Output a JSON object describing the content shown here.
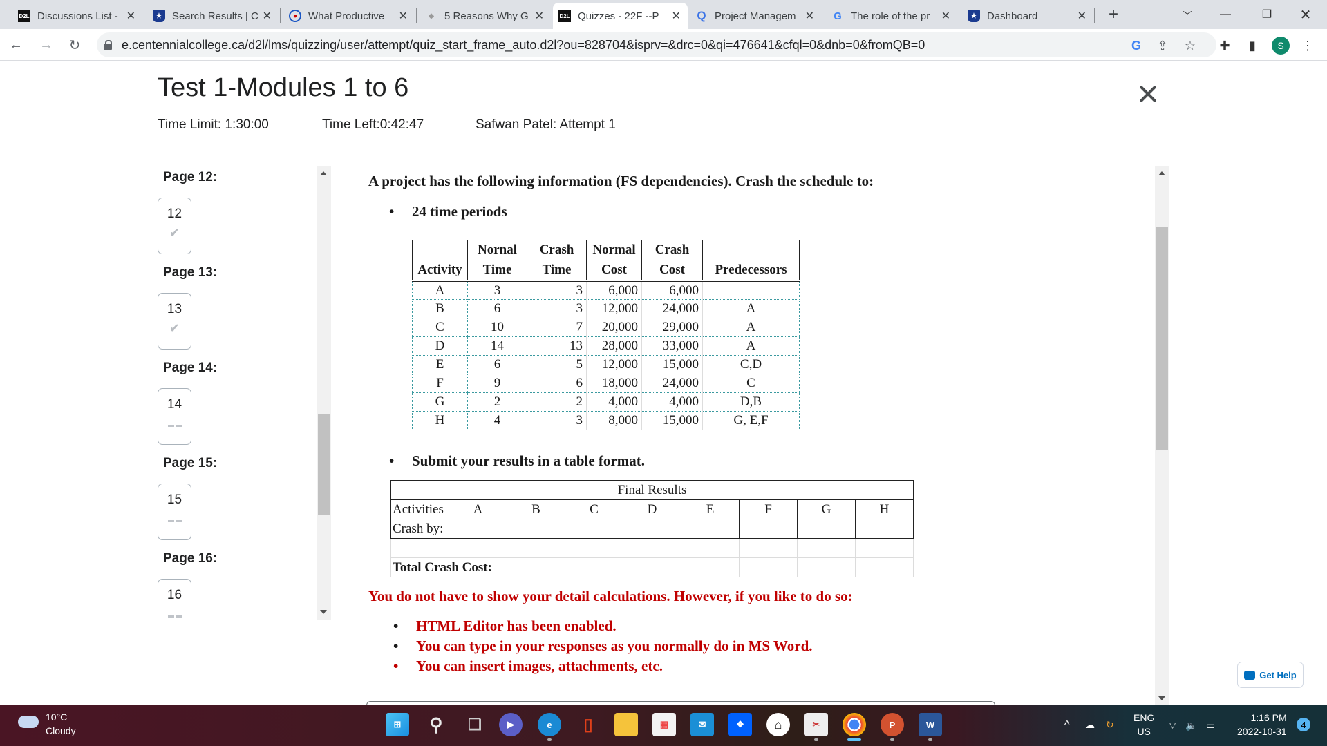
{
  "browser": {
    "tabs": [
      {
        "title": "Discussions List - ",
        "icon": "d2l-logo-icon",
        "active": false
      },
      {
        "title": "Search Results | C",
        "icon": "shield-star-icon",
        "active": false
      },
      {
        "title": "What Productive ",
        "icon": "circle-logo-icon",
        "active": false
      },
      {
        "title": "5 Reasons Why G",
        "icon": "diamond-logo-icon",
        "active": false
      },
      {
        "title": "Quizzes - 22F --P",
        "icon": "d2l-logo-icon",
        "active": true
      },
      {
        "title": "Project Managem",
        "icon": "quora-q-icon",
        "active": false
      },
      {
        "title": "The role of the pr",
        "icon": "google-g-icon",
        "active": false
      },
      {
        "title": "Dashboard",
        "icon": "shield-star-icon",
        "active": false
      }
    ],
    "new_tab_glyph": "+",
    "url": "e.centennialcollege.ca/d2l/lms/quizzing/user/attempt/quiz_start_frame_auto.d2l?ou=828704&isprv=&drc=0&qi=476641&cfql=0&dnb=0&fromQB=0",
    "profile_initial": "S"
  },
  "quiz": {
    "title": "Test 1-Modules 1 to 6",
    "time_limit": "Time Limit: 1:30:00",
    "time_left": "Time Left:0:42:47",
    "attempt": "Safwan Patel: Attempt 1"
  },
  "page_nav": [
    {
      "label": "Page 12:",
      "number": "12",
      "status": "answered"
    },
    {
      "label": "Page 13:",
      "number": "13",
      "status": "answered"
    },
    {
      "label": "Page 14:",
      "number": "14",
      "status": "unanswered"
    },
    {
      "label": "Page 15:",
      "number": "15",
      "status": "unanswered"
    },
    {
      "label": "Page 16:",
      "number": "16",
      "status": "unanswered"
    }
  ],
  "question": {
    "intro": "A project has the following information (FS dependencies).  Crash the schedule to:",
    "target": "24 time periods",
    "table": {
      "header_row1": [
        "",
        "Nornal",
        "Crash",
        "Normal",
        "Crash",
        ""
      ],
      "header_row2": [
        "Activity",
        "Time",
        "Time",
        "Cost",
        "Cost",
        "Predecessors"
      ],
      "rows": [
        [
          "A",
          "3",
          "3",
          "6,000",
          "6,000",
          ""
        ],
        [
          "B",
          "6",
          "3",
          "12,000",
          "24,000",
          "A"
        ],
        [
          "C",
          "10",
          "7",
          "20,000",
          "29,000",
          "A"
        ],
        [
          "D",
          "14",
          "13",
          "28,000",
          "33,000",
          "A"
        ],
        [
          "E",
          "6",
          "5",
          "12,000",
          "15,000",
          "C,D"
        ],
        [
          "F",
          "9",
          "6",
          "18,000",
          "24,000",
          "C"
        ],
        [
          "G",
          "2",
          "2",
          "4,000",
          "4,000",
          "D,B"
        ],
        [
          "H",
          "4",
          "3",
          "8,000",
          "15,000",
          "G, E,F"
        ]
      ]
    },
    "submit_instruction": "Submit your results in a table format.",
    "results_table": {
      "title": "Final Results",
      "activities_label": "Activities",
      "activities": [
        "A",
        "B",
        "C",
        "D",
        "E",
        "F",
        "G",
        "H"
      ],
      "crash_by_label": "Crash by:",
      "total_label": "Total Crash Cost:"
    },
    "note": "You do not have to show your detail calculations.  However, if you like to do so:",
    "note_bullets": [
      "HTML Editor has been enabled.",
      "You can type in your responses as you normally do in MS Word.",
      "You can insert images, attachments, etc."
    ]
  },
  "get_help_label": "Get Help",
  "taskbar": {
    "weather_temp": "10°C",
    "weather_desc": "Cloudy",
    "language": "ENG",
    "region": "US",
    "time": "1:16 PM",
    "date": "2022-10-31",
    "notification_count": "4"
  },
  "colors": {
    "accent_red": "#c00000",
    "help_blue": "#006fbf"
  }
}
